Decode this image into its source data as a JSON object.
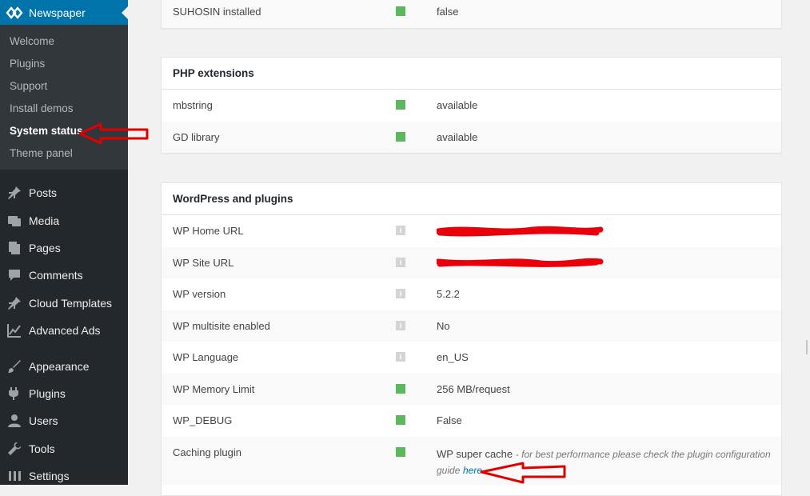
{
  "sidebar": {
    "brand": "Newspaper",
    "submenu": [
      "Welcome",
      "Plugins",
      "Support",
      "Install demos",
      "System status",
      "Theme panel"
    ],
    "current_submenu": "System status",
    "menu": [
      {
        "label": "Posts",
        "icon": "pin-icon"
      },
      {
        "label": "Media",
        "icon": "media-icon"
      },
      {
        "label": "Pages",
        "icon": "pages-icon"
      },
      {
        "label": "Comments",
        "icon": "comments-icon"
      },
      {
        "label": "Cloud Templates",
        "icon": "pin-icon"
      },
      {
        "label": "Advanced Ads",
        "icon": "chart-icon"
      },
      {
        "label": "Appearance",
        "icon": "brush-icon"
      },
      {
        "label": "Plugins",
        "icon": "plugin-icon"
      },
      {
        "label": "Users",
        "icon": "user-icon"
      },
      {
        "label": "Tools",
        "icon": "wrench-icon"
      },
      {
        "label": "Settings",
        "icon": "settings-icon"
      }
    ]
  },
  "top_panel": {
    "rows": [
      {
        "label": "SUHOSIN installed",
        "status": "ok",
        "value": "false"
      }
    ]
  },
  "php_extensions": {
    "title": "PHP extensions",
    "rows": [
      {
        "label": "mbstring",
        "status": "ok",
        "value": "available"
      },
      {
        "label": "GD library",
        "status": "ok",
        "value": "available"
      }
    ]
  },
  "wordpress": {
    "title": "WordPress and plugins",
    "rows": [
      {
        "label": "WP Home URL",
        "status": "info",
        "value": ""
      },
      {
        "label": "WP Site URL",
        "status": "info",
        "value": ""
      },
      {
        "label": "WP version",
        "status": "info",
        "value": "5.2.2"
      },
      {
        "label": "WP multisite enabled",
        "status": "info",
        "value": "No"
      },
      {
        "label": "WP Language",
        "status": "info",
        "value": "en_US"
      },
      {
        "label": "WP Memory Limit",
        "status": "ok",
        "value": "256 MB/request"
      },
      {
        "label": "WP_DEBUG",
        "status": "ok",
        "value": "False"
      },
      {
        "label": "Caching plugin",
        "status": "ok",
        "value": "WP super cache"
      }
    ],
    "caching_note_line1": "for best performance please check the plugin configuration",
    "caching_note_line2": "guide",
    "caching_link": "here"
  },
  "colors": {
    "accent": "#0073aa",
    "ok": "#5cb85c",
    "annotation": "#e00000",
    "redaction": "#e8000b"
  }
}
